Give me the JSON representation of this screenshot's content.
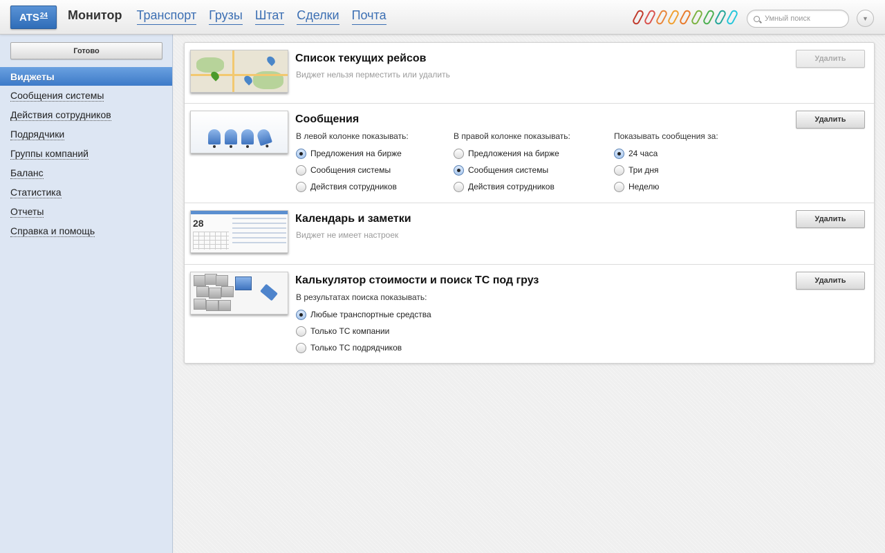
{
  "header": {
    "logo_text": "ATS",
    "logo_sup": "24",
    "active_tab": "Монитор",
    "nav_links": [
      "Транспорт",
      "Грузы",
      "Штат",
      "Сделки",
      "Почта"
    ],
    "clip_colors": [
      "#c0392b",
      "#d9534f",
      "#e8843a",
      "#f0a030",
      "#e87a2c",
      "#7cb342",
      "#4caf50",
      "#26a69a",
      "#26c6da"
    ],
    "search_placeholder": "Умный поиск"
  },
  "sidebar": {
    "done_label": "Готово",
    "section_title": "Виджеты",
    "items": [
      "Сообщения системы",
      "Действия сотрудников",
      "Подрядчики",
      "Группы компаний",
      "Баланс",
      "Статистика",
      "Отчеты",
      "Справка и помощь"
    ]
  },
  "widgets": [
    {
      "title": "Список текущих рейсов",
      "note": "Виджет нельзя перместить или удалить",
      "delete_label": "Удалить",
      "delete_disabled": true
    },
    {
      "title": "Сообщения",
      "delete_label": "Удалить",
      "columns": [
        {
          "title": "В левой колонке показывать:",
          "options": [
            "Предложения на бирже",
            "Сообщения системы",
            "Действия сотрудников"
          ],
          "selected": 0
        },
        {
          "title": "В правой колонке показывать:",
          "options": [
            "Предложения на бирже",
            "Сообщения системы",
            "Действия сотрудников"
          ],
          "selected": 1
        },
        {
          "title": "Показывать сообщения за:",
          "options": [
            "24 часа",
            "Три дня",
            "Неделю"
          ],
          "selected": 0
        }
      ]
    },
    {
      "title": "Календарь и заметки",
      "note": "Виджет не имеет настроек",
      "delete_label": "Удалить",
      "thumb_day": "28"
    },
    {
      "title": "Калькулятор стоимости и поиск ТС под груз",
      "delete_label": "Удалить",
      "columns": [
        {
          "title": "В результатах поиска показывать:",
          "options": [
            "Любые транспортные средства",
            "Только ТС компании",
            "Только ТС подрядчиков"
          ],
          "selected": 0
        }
      ]
    }
  ]
}
